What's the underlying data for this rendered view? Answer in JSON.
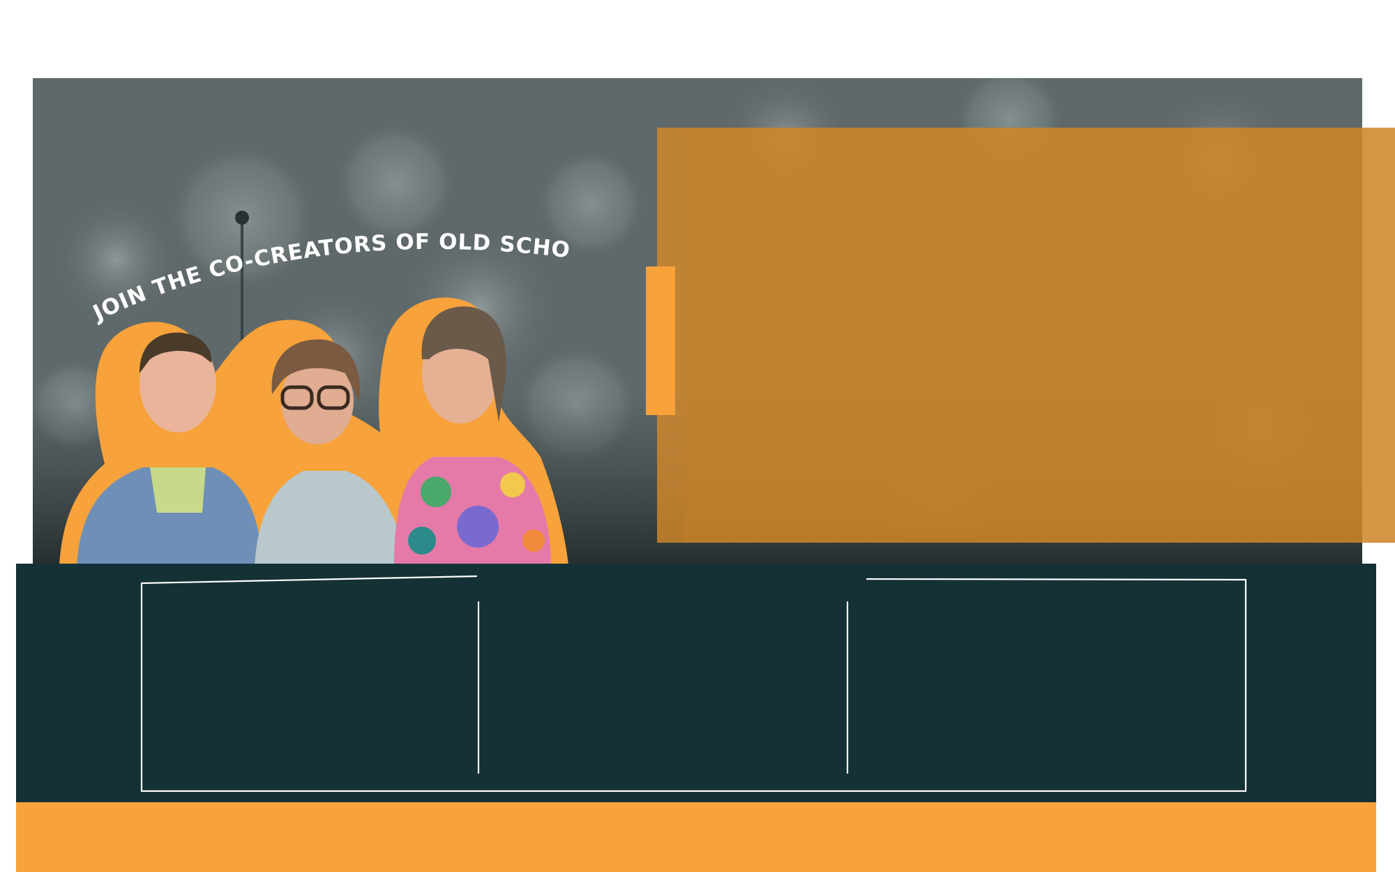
{
  "hero": {
    "heading": "JOIN THE  CO-CREATORS OF  OLD SCHOOL",
    "background_image": "bokeh-dandelion-photo",
    "people_image": "three-laughing-co-creators-photo"
  },
  "stats": {
    "cards": [
      {
        "label": ""
      },
      {
        "label": ""
      },
      {
        "label": ""
      }
    ]
  },
  "footer_band": {
    "label": ""
  },
  "colors": {
    "accent_orange": "#f7a23b",
    "panel_orange": "#d68a28",
    "dark_teal": "#143136",
    "hero_gray": "#5a6466"
  }
}
